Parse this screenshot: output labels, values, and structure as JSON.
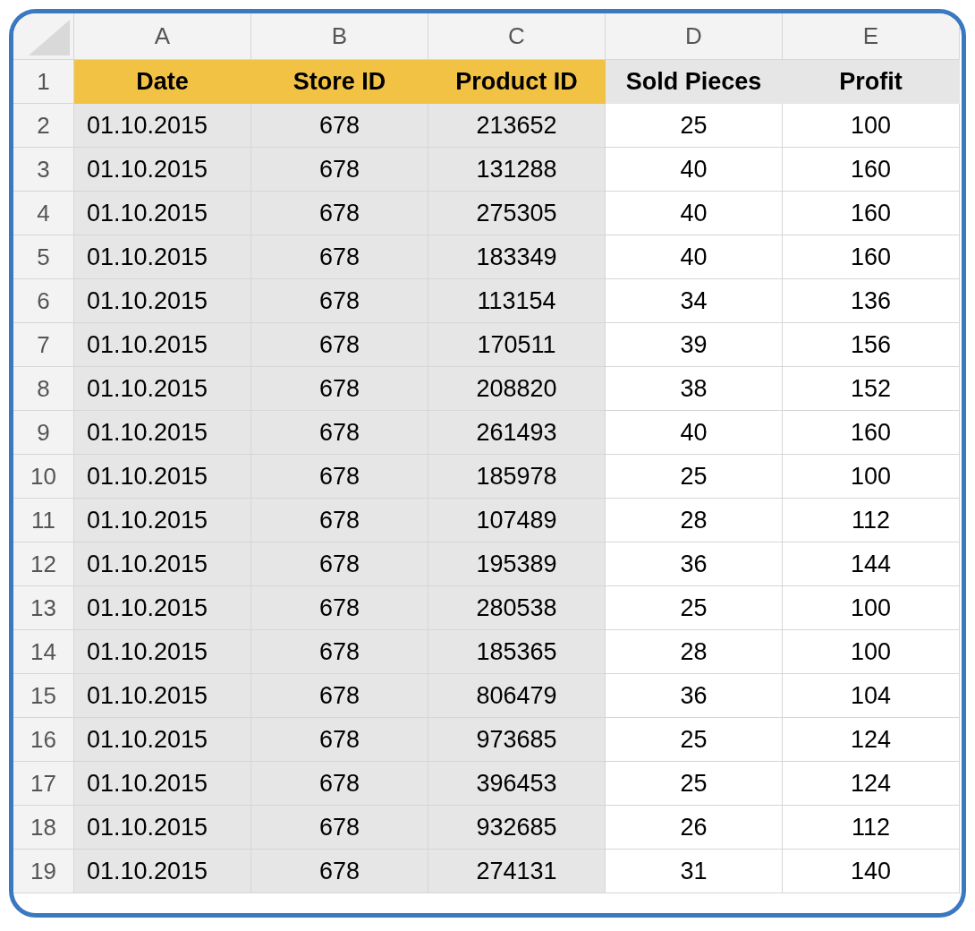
{
  "columns": [
    {
      "letter": "A",
      "highlighted": true
    },
    {
      "letter": "B",
      "highlighted": true
    },
    {
      "letter": "C",
      "highlighted": true
    },
    {
      "letter": "D",
      "highlighted": false
    },
    {
      "letter": "E",
      "highlighted": false
    }
  ],
  "header_row": {
    "number": "1",
    "cells": [
      "Date",
      "Store ID",
      "Product ID",
      "Sold Pieces",
      "Profit"
    ]
  },
  "rows": [
    {
      "number": "2",
      "cells": [
        "01.10.2015",
        "678",
        "213652",
        "25",
        "100"
      ]
    },
    {
      "number": "3",
      "cells": [
        "01.10.2015",
        "678",
        "131288",
        "40",
        "160"
      ]
    },
    {
      "number": "4",
      "cells": [
        "01.10.2015",
        "678",
        "275305",
        "40",
        "160"
      ]
    },
    {
      "number": "5",
      "cells": [
        "01.10.2015",
        "678",
        "183349",
        "40",
        "160"
      ]
    },
    {
      "number": "6",
      "cells": [
        "01.10.2015",
        "678",
        "113154",
        "34",
        "136"
      ]
    },
    {
      "number": "7",
      "cells": [
        "01.10.2015",
        "678",
        "170511",
        "39",
        "156"
      ]
    },
    {
      "number": "8",
      "cells": [
        "01.10.2015",
        "678",
        "208820",
        "38",
        "152"
      ]
    },
    {
      "number": "9",
      "cells": [
        "01.10.2015",
        "678",
        "261493",
        "40",
        "160"
      ]
    },
    {
      "number": "10",
      "cells": [
        "01.10.2015",
        "678",
        "185978",
        "25",
        "100"
      ]
    },
    {
      "number": "11",
      "cells": [
        "01.10.2015",
        "678",
        "107489",
        "28",
        "112"
      ]
    },
    {
      "number": "12",
      "cells": [
        "01.10.2015",
        "678",
        "195389",
        "36",
        "144"
      ]
    },
    {
      "number": "13",
      "cells": [
        "01.10.2015",
        "678",
        "280538",
        "25",
        "100"
      ]
    },
    {
      "number": "14",
      "cells": [
        "01.10.2015",
        "678",
        "185365",
        "28",
        "100"
      ]
    },
    {
      "number": "15",
      "cells": [
        "01.10.2015",
        "678",
        "806479",
        "36",
        "104"
      ]
    },
    {
      "number": "16",
      "cells": [
        "01.10.2015",
        "678",
        "973685",
        "25",
        "124"
      ]
    },
    {
      "number": "17",
      "cells": [
        "01.10.2015",
        "678",
        "396453",
        "25",
        "124"
      ]
    },
    {
      "number": "18",
      "cells": [
        "01.10.2015",
        "678",
        "932685",
        "26",
        "112"
      ]
    },
    {
      "number": "19",
      "cells": [
        "01.10.2015",
        "678",
        "274131",
        "31",
        "140"
      ]
    }
  ]
}
